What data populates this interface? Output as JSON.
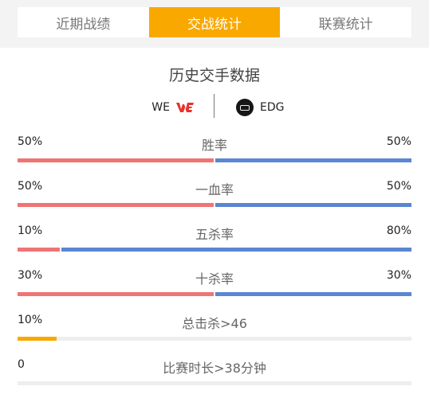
{
  "tabs": [
    {
      "label": "近期战绩",
      "active": false
    },
    {
      "label": "交战统计",
      "active": true
    },
    {
      "label": "联赛统计",
      "active": false
    }
  ],
  "title": "历史交手数据",
  "team_left": {
    "name": "WE",
    "logo_icon": "we-logo-icon"
  },
  "team_right": {
    "name": "EDG",
    "logo_icon": "edg-logo-icon"
  },
  "colors": {
    "accent": "#f9a800",
    "left_team": "#f07474",
    "right_team": "#5b86d1"
  },
  "stats": [
    {
      "label": "胜率",
      "left": "50%",
      "right": "50%",
      "left_fraction": 0.5
    },
    {
      "label": "一血率",
      "left": "50%",
      "right": "50%",
      "left_fraction": 0.5
    },
    {
      "label": "五杀率",
      "left": "10%",
      "right": "80%",
      "left_fraction": 0.11
    },
    {
      "label": "十杀率",
      "left": "30%",
      "right": "30%",
      "left_fraction": 0.5
    }
  ],
  "single_stats": [
    {
      "label": "总击杀>46",
      "value": "10%",
      "fraction": 0.1
    },
    {
      "label": "比赛时长>38分钟",
      "value": "0",
      "fraction": 0
    }
  ]
}
